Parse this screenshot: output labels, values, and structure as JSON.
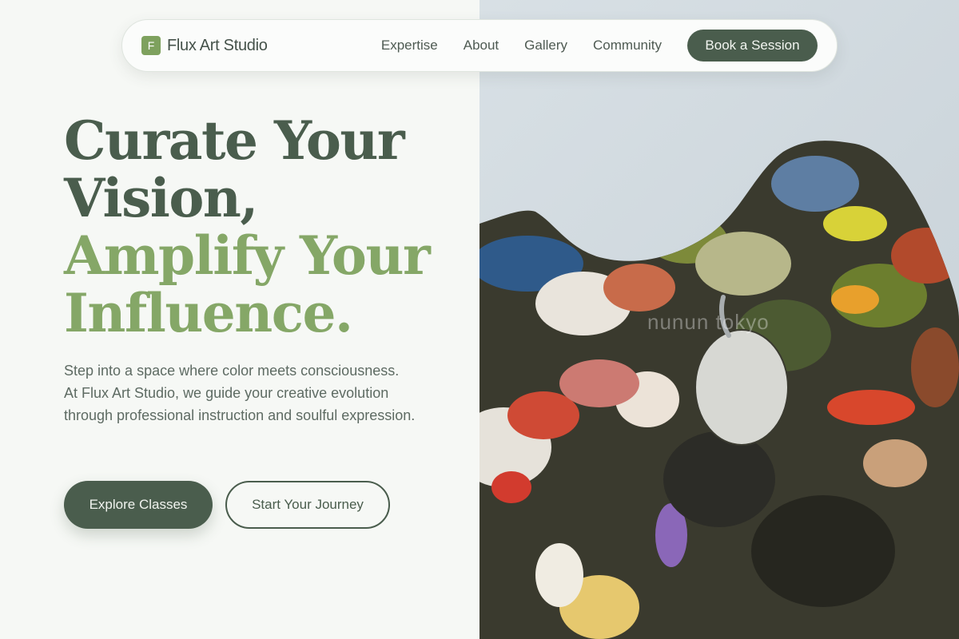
{
  "brand": {
    "mark": "F",
    "name": "Flux Art Studio"
  },
  "nav": {
    "links": [
      "Expertise",
      "About",
      "Gallery",
      "Community"
    ],
    "cta": "Book a Session"
  },
  "hero": {
    "line1": "Curate Your",
    "line2": "Vision,",
    "line3": "Amplify Your",
    "line4": "Influence.",
    "subtext": "Step into a space where color meets consciousness. At Flux Art Studio, we guide your creative evolution through professional instruction and soulful expression.",
    "primary_button": "Explore Classes",
    "secondary_button": "Start Your Journey"
  },
  "image": {
    "watermark": "nunun tokyo"
  },
  "colors": {
    "accent_dark": "#4a5d4d",
    "accent_light": "#85a767",
    "background": "#f6f8f5"
  }
}
